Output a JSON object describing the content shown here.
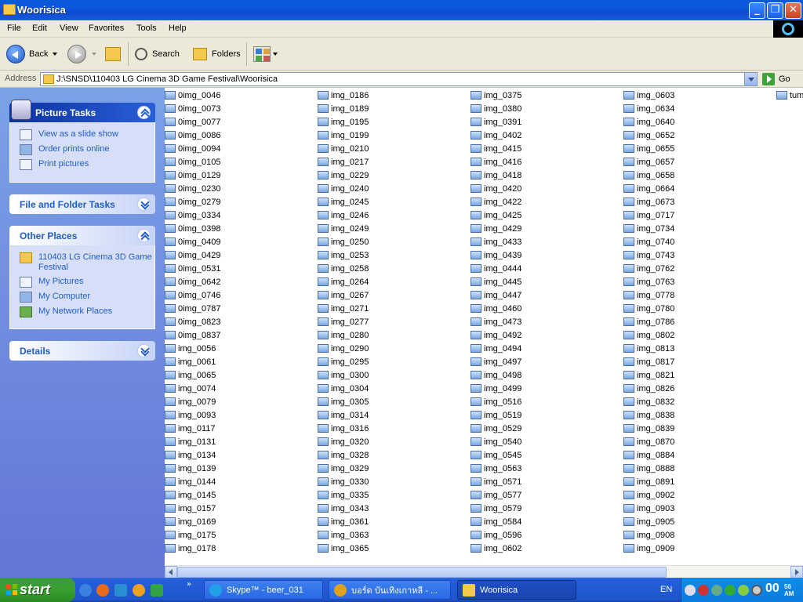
{
  "window": {
    "title": "Woorisica"
  },
  "menu": [
    "File",
    "Edit",
    "View",
    "Favorites",
    "Tools",
    "Help"
  ],
  "toolbar": {
    "back": "Back",
    "search": "Search",
    "folders": "Folders"
  },
  "address": {
    "label": "Address",
    "path": "J:\\SNSD\\110403 LG Cinema 3D Game Festival\\Woorisica",
    "go": "Go"
  },
  "taskpane": {
    "picture_tasks": {
      "title": "Picture Tasks",
      "items": [
        "View as a slide show",
        "Order prints online",
        "Print pictures"
      ]
    },
    "file_folder_tasks": {
      "title": "File and Folder Tasks"
    },
    "other_places": {
      "title": "Other Places",
      "items": [
        "110403 LG Cinema 3D Game Festival",
        "My Pictures",
        "My Computer",
        "My Network Places"
      ]
    },
    "details": {
      "title": "Details"
    }
  },
  "files": {
    "col1": [
      "0img_0046",
      "0img_0073",
      "0img_0077",
      "0img_0086",
      "0img_0094",
      "0img_0105",
      "0img_0129",
      "0img_0230",
      "0img_0279",
      "0img_0334",
      "0img_0398",
      "0img_0409",
      "0img_0429",
      "0img_0531",
      "0img_0642",
      "0img_0746",
      "0img_0787",
      "0img_0823",
      "0img_0837",
      "img_0056",
      "img_0061",
      "img_0065",
      "img_0074",
      "img_0079",
      "img_0093",
      "img_0117",
      "img_0131",
      "img_0134",
      "img_0139",
      "img_0144",
      "img_0145",
      "img_0157",
      "img_0169",
      "img_0175",
      "img_0178"
    ],
    "col2": [
      "img_0186",
      "img_0189",
      "img_0195",
      "img_0199",
      "img_0210",
      "img_0217",
      "img_0229",
      "img_0240",
      "img_0245",
      "img_0246",
      "img_0249",
      "img_0250",
      "img_0253",
      "img_0258",
      "img_0264",
      "img_0267",
      "img_0271",
      "img_0277",
      "img_0280",
      "img_0290",
      "img_0295",
      "img_0300",
      "img_0304",
      "img_0305",
      "img_0314",
      "img_0316",
      "img_0320",
      "img_0328",
      "img_0329",
      "img_0330",
      "img_0335",
      "img_0343",
      "img_0361",
      "img_0363",
      "img_0365"
    ],
    "col3": [
      "img_0375",
      "img_0380",
      "img_0391",
      "img_0402",
      "img_0415",
      "img_0416",
      "img_0418",
      "img_0420",
      "img_0422",
      "img_0425",
      "img_0429",
      "img_0433",
      "img_0439",
      "img_0444",
      "img_0445",
      "img_0447",
      "img_0460",
      "img_0473",
      "img_0492",
      "img_0494",
      "img_0497",
      "img_0498",
      "img_0499",
      "img_0516",
      "img_0519",
      "img_0529",
      "img_0540",
      "img_0545",
      "img_0563",
      "img_0571",
      "img_0577",
      "img_0579",
      "img_0584",
      "img_0596",
      "img_0602"
    ],
    "col4": [
      "img_0603",
      "img_0634",
      "img_0640",
      "img_0652",
      "img_0655",
      "img_0657",
      "img_0658",
      "img_0664",
      "img_0673",
      "img_0717",
      "img_0734",
      "img_0740",
      "img_0743",
      "img_0762",
      "img_0763",
      "img_0778",
      "img_0780",
      "img_0786",
      "img_0802",
      "img_0813",
      "img_0817",
      "img_0821",
      "img_0826",
      "img_0832",
      "img_0838",
      "img_0839",
      "img_0870",
      "img_0884",
      "img_0888",
      "img_0891",
      "img_0902",
      "img_0903",
      "img_0905",
      "img_0908",
      "img_0909"
    ],
    "col5": [
      "tum"
    ]
  },
  "taskbar": {
    "start": "start",
    "tasks": [
      "Skype™ - beer_031",
      "บอร์ด บันเทิงเกาหลี - ...",
      "Woorisica"
    ],
    "lang": "EN",
    "clock": "00",
    "clock_min": "56 AM"
  },
  "colors": {
    "title_bar": "#0a5ad9",
    "task_pane": "#6375d6",
    "start": "#37a12f"
  }
}
